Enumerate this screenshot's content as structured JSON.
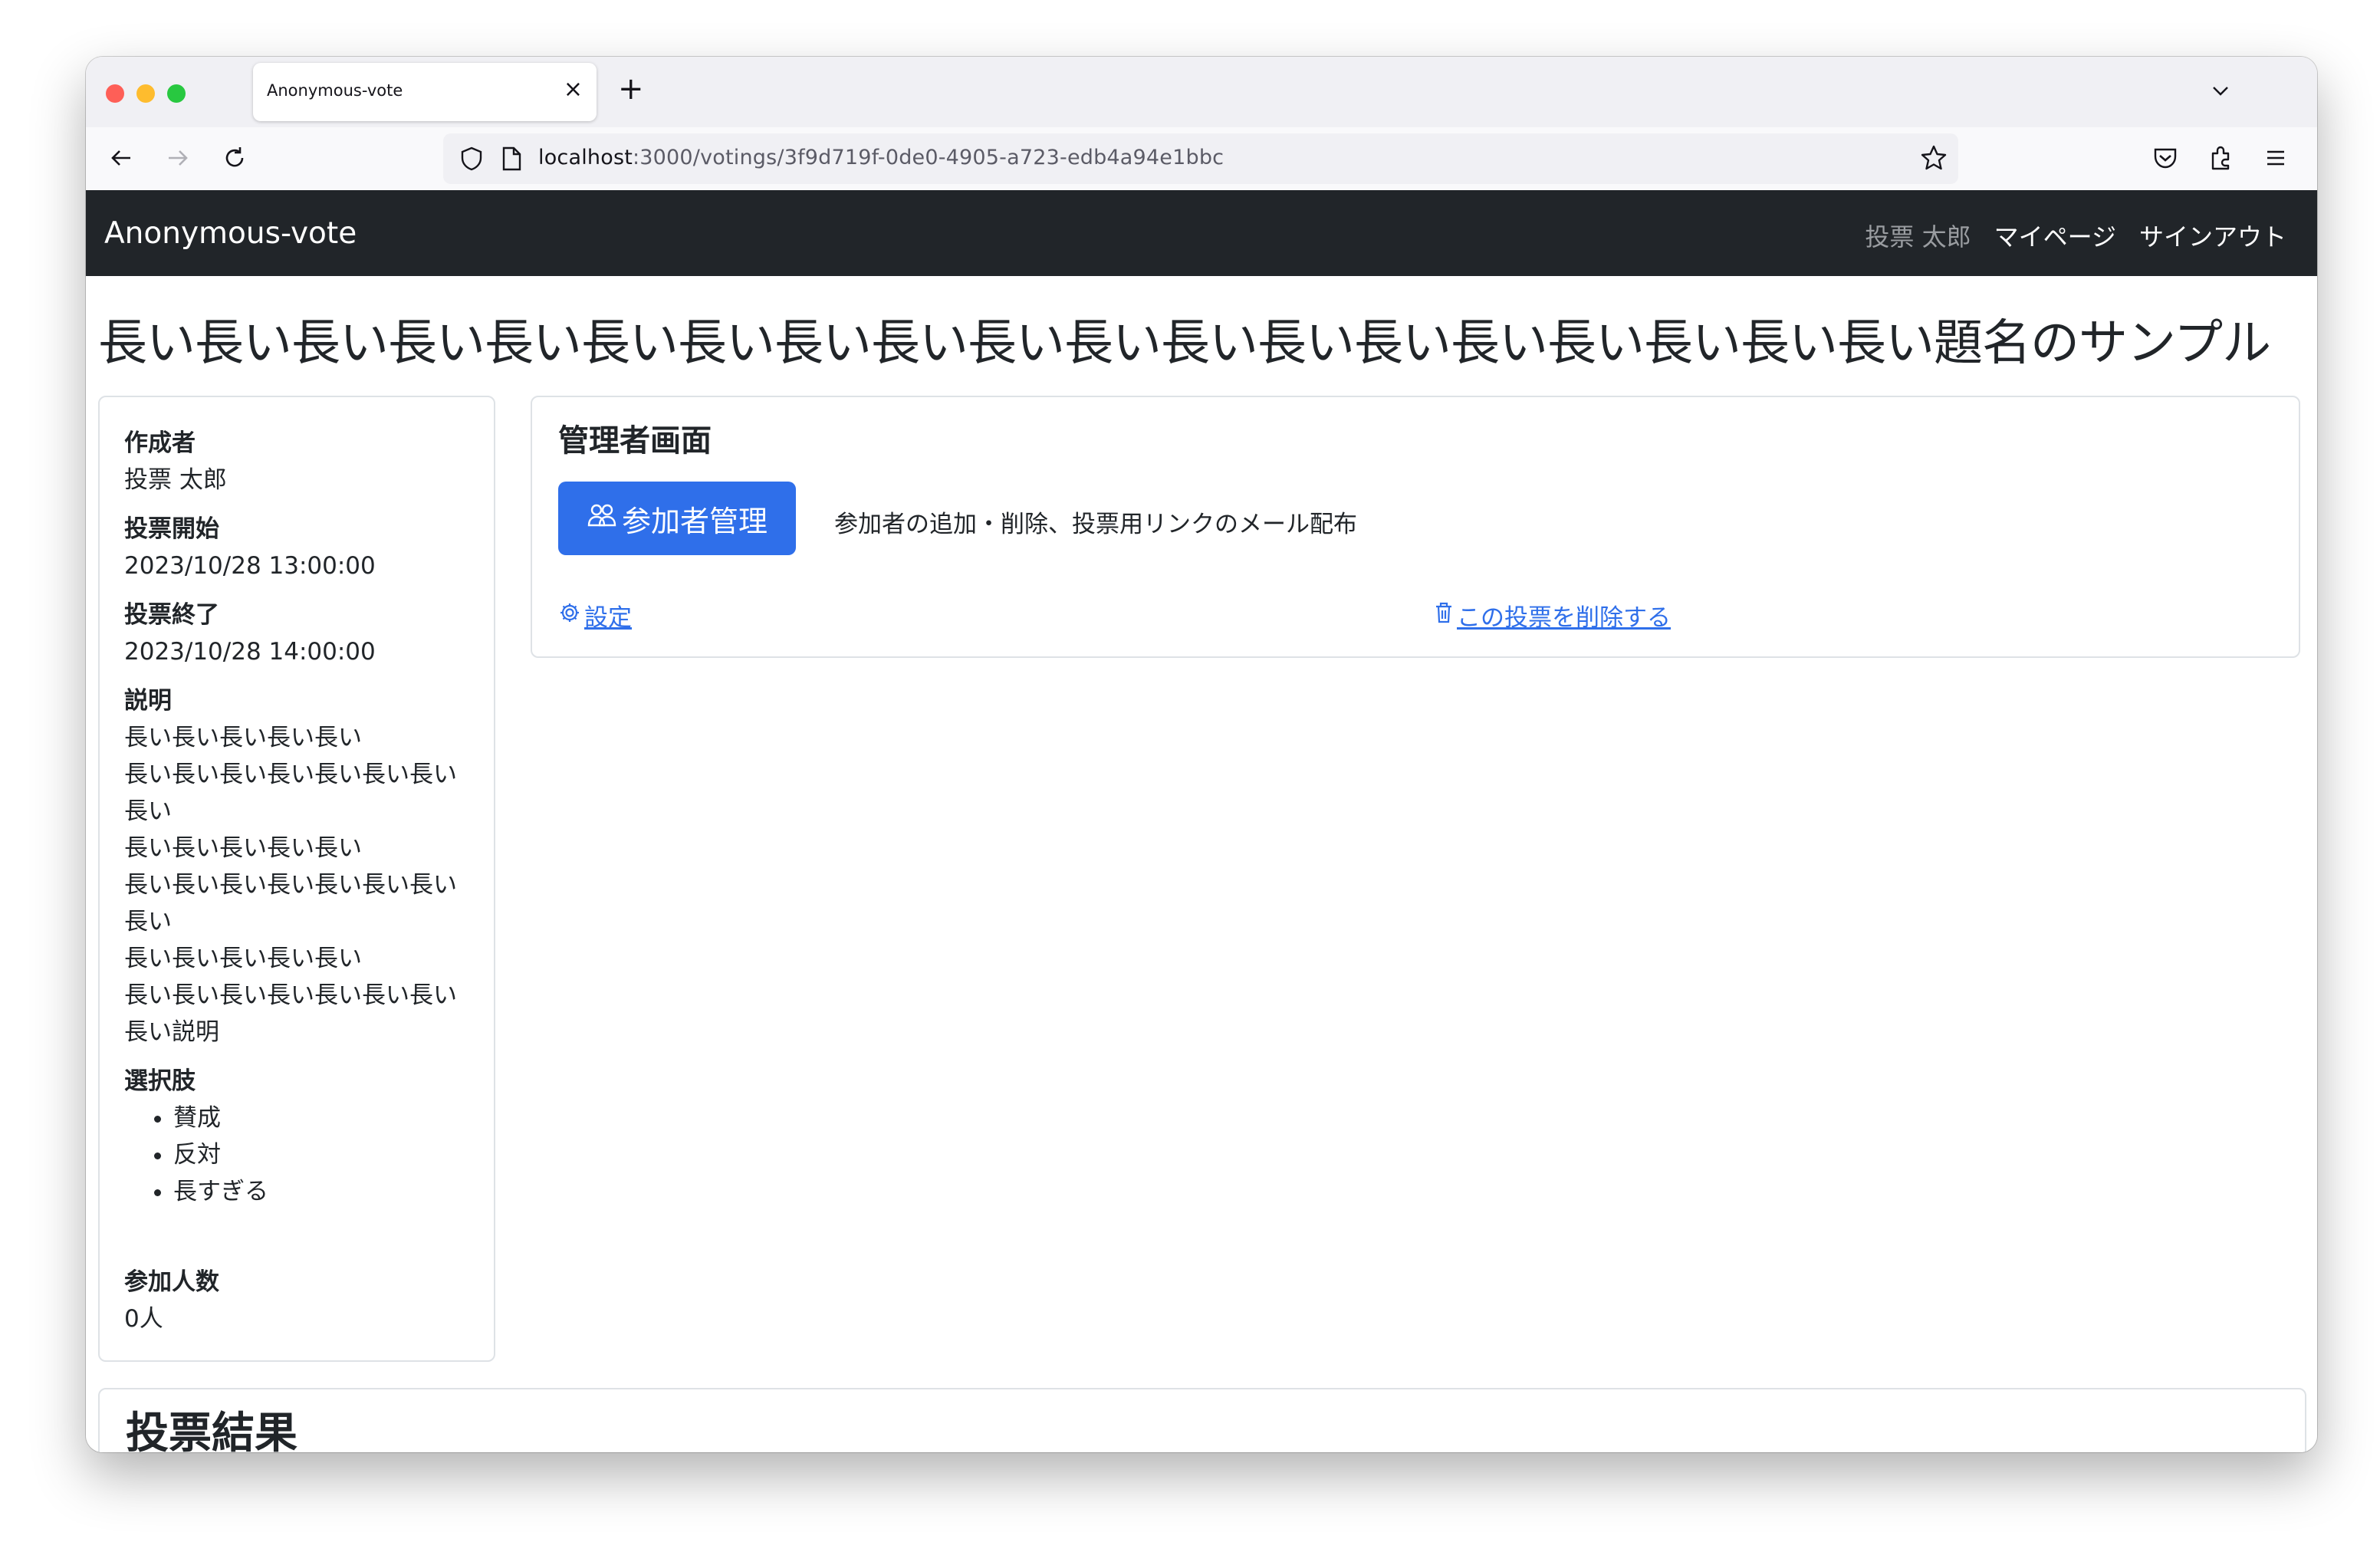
{
  "browser": {
    "tab_title": "Anonymous-vote",
    "url_host": "localhost",
    "url_rest": ":3000/votings/3f9d719f-0de0-4905-a723-edb4a94e1bbc"
  },
  "navbar": {
    "brand": "Anonymous-vote",
    "user_name": "投票 太郎",
    "mypage": "マイページ",
    "signout": "サインアウト"
  },
  "page": {
    "title": "長い長い長い長い長い長い長い長い長い長い長い長い長い長い長い長い長い長い長い題名のサンプル"
  },
  "sidebar": {
    "author_label": "作成者",
    "author": "投票 太郎",
    "start_label": "投票開始",
    "start": "2023/10/28 13:00:00",
    "end_label": "投票終了",
    "end": "2023/10/28 14:00:00",
    "description_label": "説明",
    "description_lines": [
      "長い長い長い長い長い",
      "長い長い長い長い長い長い長い",
      "長い",
      "長い長い長い長い長い",
      "長い長い長い長い長い長い長い",
      "長い",
      "長い長い長い長い長い",
      "長い長い長い長い長い長い長い",
      "長い説明"
    ],
    "choices_label": "選択肢",
    "choices": [
      "賛成",
      "反対",
      "長すぎる"
    ],
    "participants_label": "参加人数",
    "participants": "0人"
  },
  "admin": {
    "title": "管理者画面",
    "manage_button": "参加者管理",
    "manage_description": "参加者の追加・削除、投票用リンクのメール配布",
    "settings_link": "設定",
    "delete_link": "この投票を削除する"
  },
  "results": {
    "title": "投票結果"
  },
  "colors": {
    "navbar_bg": "#212529",
    "primary": "#2f6fea"
  }
}
